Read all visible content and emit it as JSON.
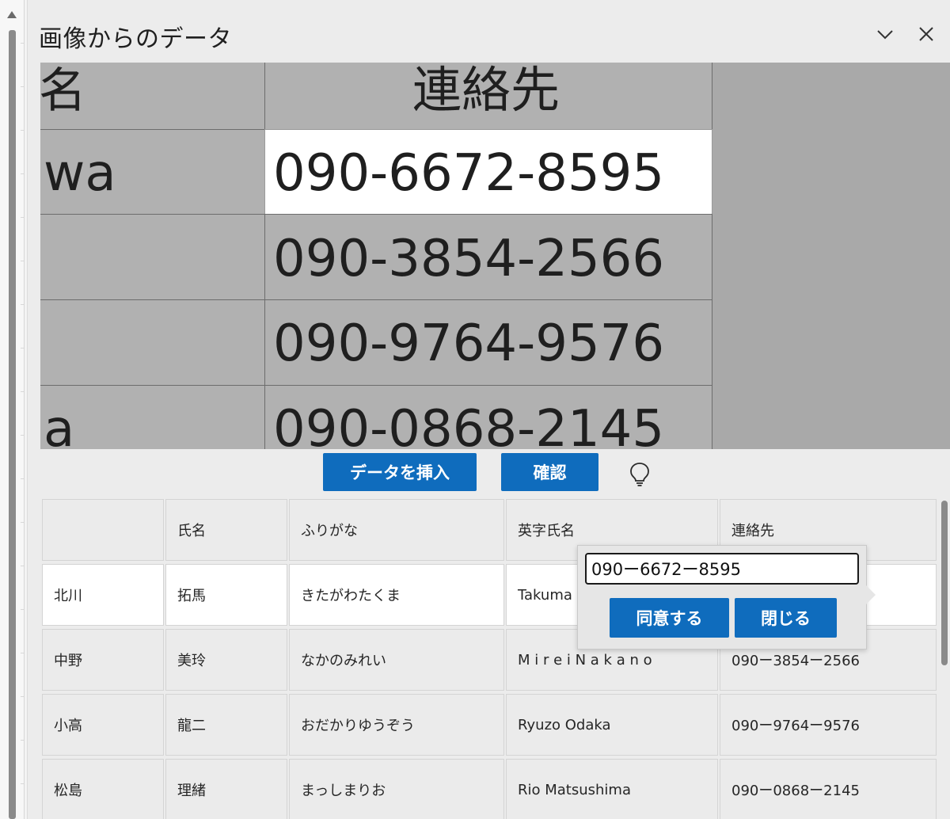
{
  "pane": {
    "title": "画像からのデータ"
  },
  "preview": {
    "header_left": "名",
    "header_right": "連絡先",
    "rows": [
      {
        "left": "wa",
        "right": "090-6672-8595"
      },
      {
        "left": "",
        "right": "090-3854-2566"
      },
      {
        "left": "",
        "right": "090-9764-9576"
      },
      {
        "left": "a",
        "right": "090-0868-2145"
      }
    ]
  },
  "actions": {
    "insert_label": "データを挿入",
    "review_label": "確認"
  },
  "grid": {
    "headers": [
      "",
      "氏名",
      "ふりがな",
      "英字氏名",
      "連絡先"
    ],
    "rows": [
      [
        "北川",
        "拓馬",
        "きたがわたくま",
        "Takuma K",
        ""
      ],
      [
        "中野",
        "美玲",
        "なかのみれい",
        "M i r e i N a k a n o",
        "090ー3854ー2566"
      ],
      [
        "小高",
        "龍二",
        "おだかりゆうぞう",
        "Ryuzo Odaka",
        "090ー9764ー9576"
      ],
      [
        "松島",
        "理緒",
        "まっしまりお",
        "Rio Matsushima",
        "090ー0868ー2145"
      ]
    ]
  },
  "popover": {
    "value": "090ー6672ー8595",
    "accept_label": "同意する",
    "close_label": "閉じる"
  },
  "colors": {
    "accent": "#0f6cbd",
    "pane_bg": "#ececec",
    "image_bg": "#a9a9a9"
  },
  "icons": [
    "chevron-down-icon",
    "close-icon",
    "lightbulb-icon",
    "scroll-up-arrow-icon"
  ]
}
